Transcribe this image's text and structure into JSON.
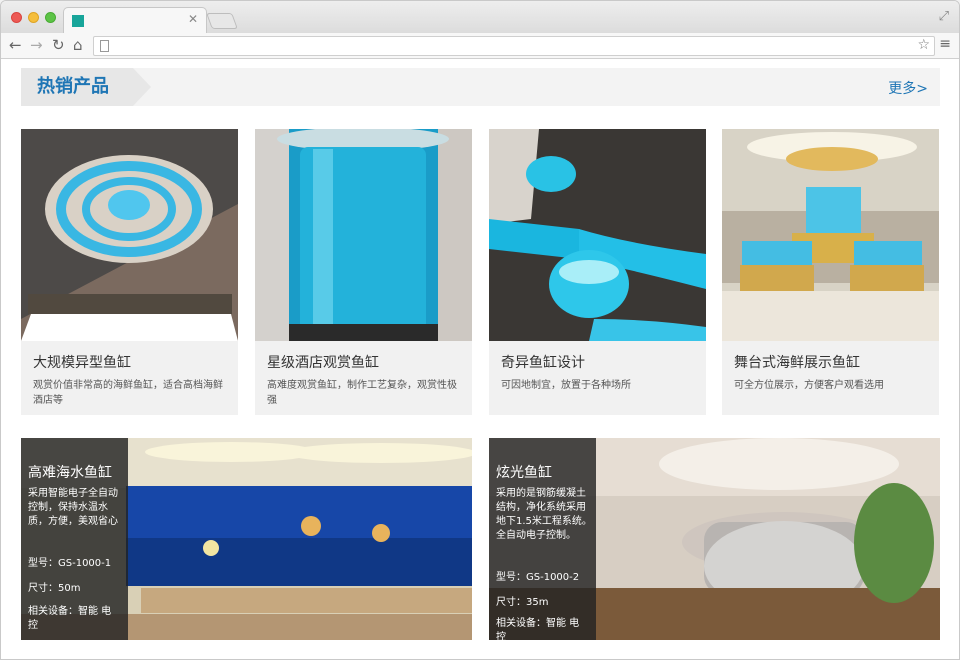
{
  "browser": {
    "tab_title": "",
    "url": ""
  },
  "section": {
    "title": "热销产品",
    "more": "更多>"
  },
  "products": [
    {
      "title": "大规模异型鱼缸",
      "desc": "观赏价值非常高的海鲜鱼缸，适合高档海鲜酒店等"
    },
    {
      "title": "星级酒店观赏鱼缸",
      "desc": "高难度观赏鱼缸，制作工艺复杂，观赏性极强"
    },
    {
      "title": "奇异鱼缸设计",
      "desc": "可因地制宜，放置于各种场所"
    },
    {
      "title": "舞台式海鲜展示鱼缸",
      "desc": "可全方位展示，方便客户观看选用"
    }
  ],
  "featured": [
    {
      "title": "高难海水鱼缸",
      "desc": "采用智能电子全自动控制，保持水温水质，方便，美观省心",
      "model": "型号：GS-1000-1",
      "size": "尺寸：50m",
      "equipment": "相关设备：智能 电控"
    },
    {
      "title": "炫光鱼缸",
      "desc": "采用的是钢筋缓凝土结构，净化系统采用地下1.5米工程系统。全自动电子控制。",
      "model": "型号：GS-1000-2",
      "size": "尺寸：35m",
      "equipment": "相关设备：智能 电控"
    }
  ]
}
